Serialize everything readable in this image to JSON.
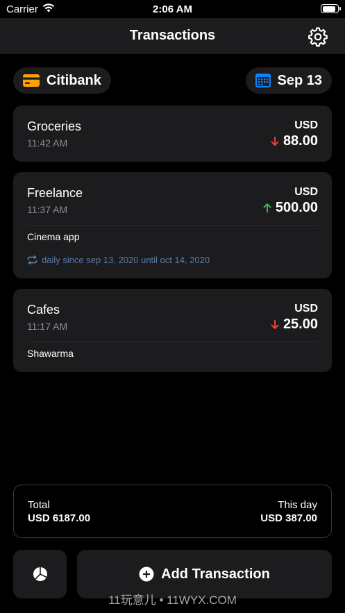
{
  "status_bar": {
    "carrier": "Carrier",
    "time": "2:06 AM",
    "battery_level": 0.9
  },
  "nav": {
    "title": "Transactions"
  },
  "account": {
    "name": "Citibank"
  },
  "date_picker": {
    "label": "Sep 13"
  },
  "transactions": [
    {
      "name": "Groceries",
      "time": "11:42 AM",
      "currency": "USD",
      "amount": "88.00",
      "direction": "down"
    },
    {
      "name": "Freelance",
      "time": "11:37 AM",
      "currency": "USD",
      "amount": "500.00",
      "direction": "up",
      "note": "Cinema app",
      "recurrence": "daily since sep 13, 2020 until oct 14, 2020"
    },
    {
      "name": "Cafes",
      "time": "11:17 AM",
      "currency": "USD",
      "amount": "25.00",
      "direction": "down",
      "note": "Shawarma"
    }
  ],
  "totals": {
    "total_label": "Total",
    "total_value": "USD 6187.00",
    "today_label": "This day",
    "today_value": "USD 387.00"
  },
  "actions": {
    "add_label": "Add Transaction"
  },
  "watermark": "11玩意儿 • 11WYX.COM",
  "colors": {
    "income": "#34c759",
    "expense": "#ff453a",
    "account_icon": "#ff9f0a",
    "calendar_icon": "#0a84ff",
    "recurrence": "#5a7ea6"
  }
}
